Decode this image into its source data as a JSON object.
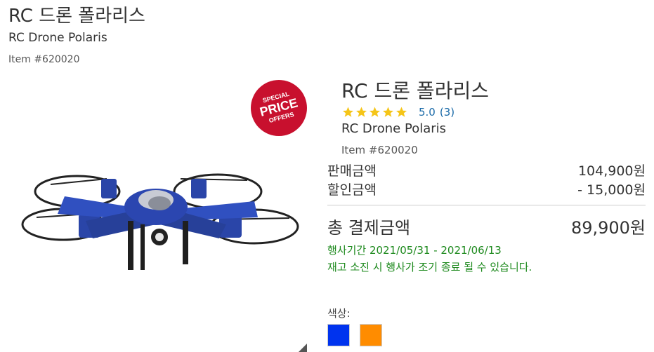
{
  "header": {
    "title": "RC 드론 폴라리스",
    "subtitle": "RC Drone Polaris",
    "item_number": "Item #620020"
  },
  "badge": {
    "line1": "SPECIAL",
    "line2": "PRICE",
    "line3": "OFFERS",
    "color": "#c8102e"
  },
  "product": {
    "title": "RC 드론 폴라리스",
    "rating": {
      "stars": 5,
      "score": "5.0",
      "count": "(3)"
    },
    "subtitle": "RC Drone Polaris",
    "item_number": "Item #620020",
    "image_icon": "drone-product-image"
  },
  "pricing": {
    "sale_label": "판매금액",
    "sale_value": "104,900원",
    "discount_label": "할인금액",
    "discount_value": "- 15,000원",
    "total_label": "총 결제금액",
    "total_value": "89,900원"
  },
  "promotion": {
    "period": "행사기간 2021/05/31 - 2021/06/13",
    "notice": "재고 소진 시 행사가 조기 종료 될 수 있습니다."
  },
  "options": {
    "color_label": "색상:",
    "swatches": [
      {
        "color": "#0033ee"
      },
      {
        "color": "#ff8c00"
      }
    ]
  },
  "colors": {
    "star": "#f5c518",
    "promo_text": "#1e8a1e",
    "rating_link": "#1a6aa8"
  }
}
